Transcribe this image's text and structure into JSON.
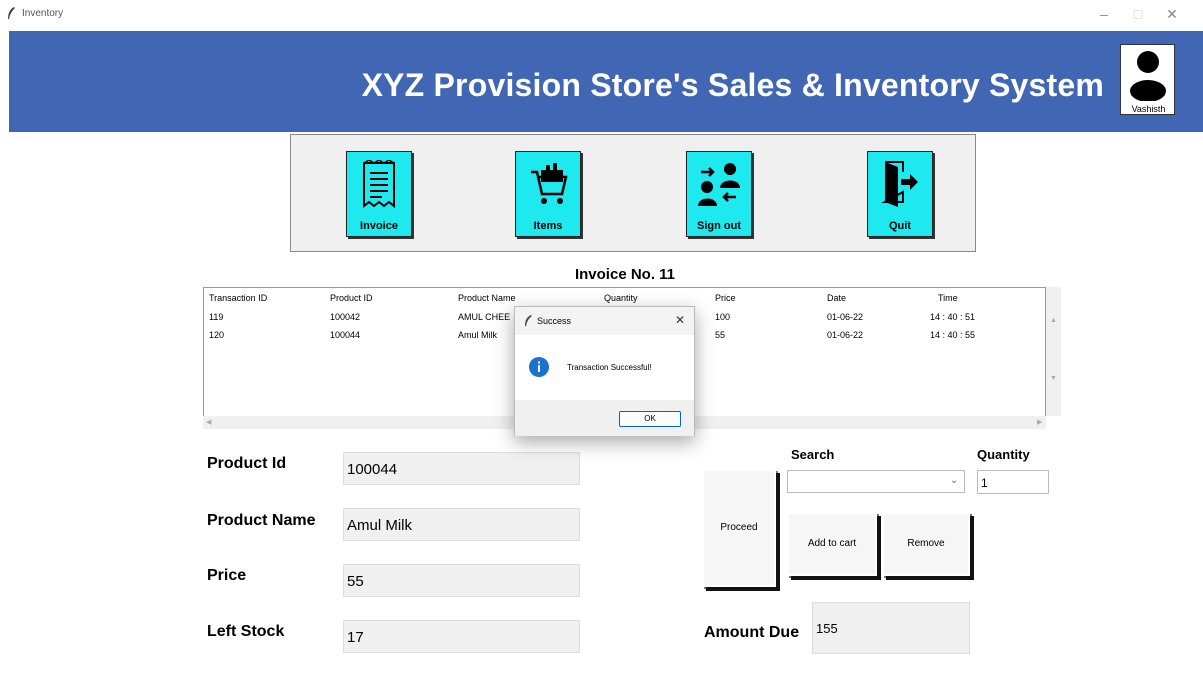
{
  "window": {
    "title": "Inventory",
    "controls": [
      "–",
      "□",
      "✕"
    ]
  },
  "header": {
    "title": "XYZ Provision Store's Sales & Inventory System",
    "username": "Vashisth",
    "bg_color": "#4167b4"
  },
  "toolbar": {
    "button_color": "#1ee9ee",
    "buttons": [
      {
        "label": "Invoice",
        "icon": "receipt-icon"
      },
      {
        "label": "Items",
        "icon": "shopping-cart-icon"
      },
      {
        "label": "Sign out",
        "icon": "switch-user-icon"
      },
      {
        "label": "Quit",
        "icon": "exit-door-icon"
      }
    ]
  },
  "invoice": {
    "title": "Invoice No. 11",
    "columns": [
      "Transaction ID",
      "Product ID",
      "Product Name",
      "Quantity",
      "Price",
      "Date",
      "Time"
    ],
    "rows": [
      [
        "119",
        "100042",
        "AMUL CHEE",
        "",
        "100",
        "01-06-22",
        "14 : 40 : 51"
      ],
      [
        "120",
        "100044",
        "Amul Milk",
        "",
        "55",
        "01-06-22",
        "14 : 40 : 55"
      ]
    ]
  },
  "form": {
    "product_id_label": "Product Id",
    "product_id": "100044",
    "product_name_label": "Product Name",
    "product_name": "Amul Milk",
    "price_label": "Price",
    "price": "55",
    "left_stock_label": "Left Stock",
    "left_stock": "17"
  },
  "actions": {
    "search_label": "Search",
    "search_value": "",
    "quantity_label": "Quantity",
    "quantity_value": "1",
    "proceed_label": "Proceed",
    "add_to_cart_label": "Add to cart",
    "remove_label": "Remove",
    "amount_due_label": "Amount Due",
    "amount_due": "155"
  },
  "dialog": {
    "title": "Success",
    "message": "Transaction Successful!",
    "ok_label": "OK",
    "icon": "info-icon"
  }
}
